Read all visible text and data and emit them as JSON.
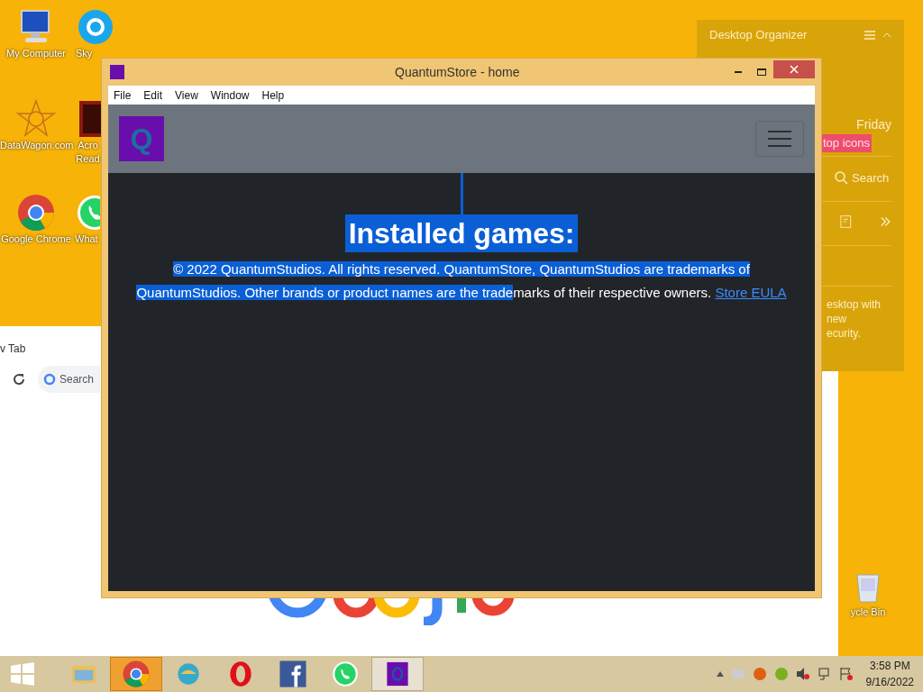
{
  "desktop_icons": [
    {
      "label": "My Computer",
      "kind": "computer"
    },
    {
      "label": "Sky",
      "kind": "skype"
    },
    {
      "label": "DataWagon.com",
      "kind": "star"
    },
    {
      "label": "Acro Read",
      "kind": "acrobat"
    },
    {
      "label": "Google Chrome",
      "kind": "chrome"
    },
    {
      "label": "What",
      "kind": "whatsapp"
    },
    {
      "label": "ycle Bin",
      "kind": "bin"
    }
  ],
  "organizer": {
    "title": "Desktop Organizer",
    "day": "Friday",
    "tag": "top icons",
    "search": "Search",
    "description_lines": [
      "esktop with",
      "new",
      "ecurity."
    ]
  },
  "browser": {
    "tab": "v Tab",
    "search_placeholder": "Search"
  },
  "window": {
    "title": "QuantumStore - home",
    "menu": [
      "File",
      "Edit",
      "View",
      "Window",
      "Help"
    ],
    "logo_letter": "Q",
    "heading": "Installed games:",
    "footer": {
      "selected_part": "© 2022 QuantumStudios. All rights reserved. QuantumStore, QuantumStudios are trademarks of QuantumStudios. Other brands or product names are the trade",
      "unselected_part": "marks of their respective owners.",
      "link": "Store EULA"
    }
  },
  "taskbar": {
    "apps": [
      {
        "kind": "explorer",
        "selected": false
      },
      {
        "kind": "chrome",
        "selected": true
      },
      {
        "kind": "globe",
        "selected": false
      },
      {
        "kind": "opera",
        "selected": false
      },
      {
        "kind": "facebook",
        "selected": false
      },
      {
        "kind": "whatsapp",
        "selected": false
      },
      {
        "kind": "quantum",
        "selected": true
      }
    ],
    "time": "3:58 PM",
    "date": "9/16/2022"
  }
}
